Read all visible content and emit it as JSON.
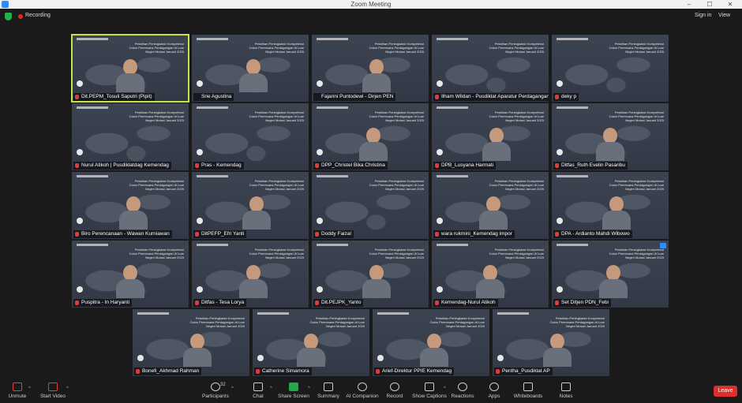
{
  "window": {
    "title": "Zoom Meeting",
    "controls": [
      "–",
      "☐",
      "✕"
    ]
  },
  "topbar": {
    "recording_label": "Recording",
    "signin_label": "Sign in",
    "view_label": "View"
  },
  "slide": {
    "title": "Pelatihan Peningkatan Kompetensi Calon Perencana Perdagangan di Luar Negeri Mutasi Januari 2025"
  },
  "tiles": [
    {
      "name": "Dit.PEPM_Tosuli Saputri (Pipit)",
      "muted": true,
      "active": true,
      "person": true
    },
    {
      "name": "Srie Agustina",
      "muted": false,
      "person": true
    },
    {
      "name": "Fajarini Puntodewi - Dirjen PEN",
      "muted": false,
      "person": true
    },
    {
      "name": "Ilham Wildan - Pusdiklat Aparatur Perdagangan",
      "muted": true,
      "person": false
    },
    {
      "name": "deky p",
      "muted": true,
      "person": false
    },
    {
      "name": "Nurul Atikoh | Pusdiklatdag Kemendag",
      "muted": true,
      "person": false
    },
    {
      "name": "Pras - Kemendag",
      "muted": true,
      "person": false
    },
    {
      "name": "DPP_Christel Bika Christina",
      "muted": true,
      "person": true
    },
    {
      "name": "DPB_Lusyana Harmati",
      "muted": true,
      "person": true
    },
    {
      "name": "Ditfas_Ruth Evelin Pasaribu",
      "muted": true,
      "person": true
    },
    {
      "name": "Biro Perencanaan - Wawan Kurniawan",
      "muted": true,
      "person": true
    },
    {
      "name": "DitPEFP_Efri Yanti",
      "muted": true,
      "person": true
    },
    {
      "name": "Doddy Faizal",
      "muted": true,
      "person": false
    },
    {
      "name": "wara rukmini_Kemendag impor",
      "muted": true,
      "person": true
    },
    {
      "name": "DPA - Ardianto Mahdi Wibowo",
      "muted": true,
      "person": true
    },
    {
      "name": "Puspitra - In Haryanti",
      "muted": true,
      "person": true
    },
    {
      "name": "Ditfas - Tesa Lorya",
      "muted": true,
      "person": true
    },
    {
      "name": "Dit.PEJPK_Yanto",
      "muted": true,
      "person": true
    },
    {
      "name": "Kemendag-Nurul Atikoh",
      "muted": true,
      "person": true
    },
    {
      "name": "Set Ditjen PDN_Febi",
      "muted": true,
      "person": true,
      "pinned": true
    },
    {
      "name": "Bonefi_Akhmad Rahman",
      "muted": true,
      "person": true
    },
    {
      "name": "Catherine Simamora",
      "muted": true,
      "person": true
    },
    {
      "name": "Arief-Direktur PPIE Kemendag",
      "muted": true,
      "person": true
    },
    {
      "name": "Pentha_Pusdiklat AP",
      "muted": true,
      "person": true
    }
  ],
  "toolbar": {
    "unmute": "Unmute",
    "start_video": "Start Video",
    "participants": "Participants",
    "participants_count": "32",
    "chat": "Chat",
    "share_screen": "Share Screen",
    "summary": "Summary",
    "ai_companion": "AI Companion",
    "record": "Record",
    "show_captions": "Show Captions",
    "reactions": "Reactions",
    "apps": "Apps",
    "whiteboards": "Whiteboards",
    "notes": "Notes",
    "leave": "Leave"
  },
  "colors": {
    "active_speaker": "#c7e34a",
    "leave": "#e02e2e",
    "share": "#23a94c",
    "recording": "#e02828"
  }
}
